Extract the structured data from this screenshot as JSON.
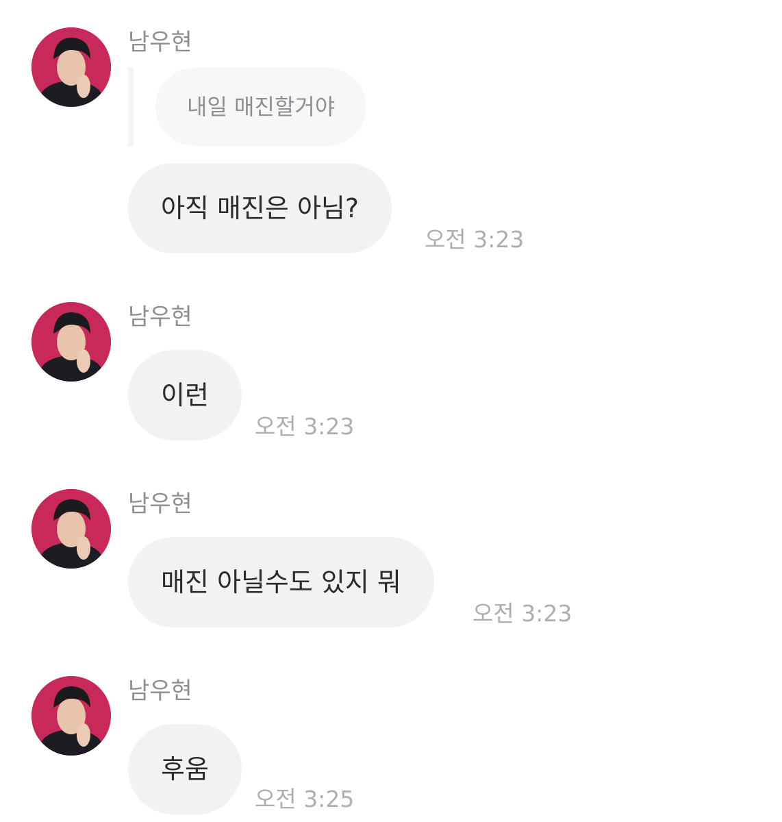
{
  "messages": [
    {
      "sender": "남우현",
      "quote": "내일 매진할거야",
      "text": "아직 매진은 아님?",
      "time": "오전 3:23"
    },
    {
      "sender": "남우현",
      "text": "이런",
      "time": "오전 3:23"
    },
    {
      "sender": "남우현",
      "text": "매진 아닐수도 있지 뭐",
      "time": "오전 3:23"
    },
    {
      "sender": "남우현",
      "text": "후움",
      "time": "오전 3:25"
    }
  ],
  "colors": {
    "avatar_background": "#c8285a",
    "bubble_background": "#f2f2f5",
    "quote_background": "#f7f7f9",
    "text": "#2b2b2e",
    "secondary_text": "#8e8e93",
    "timestamp": "#aeaeb2"
  }
}
